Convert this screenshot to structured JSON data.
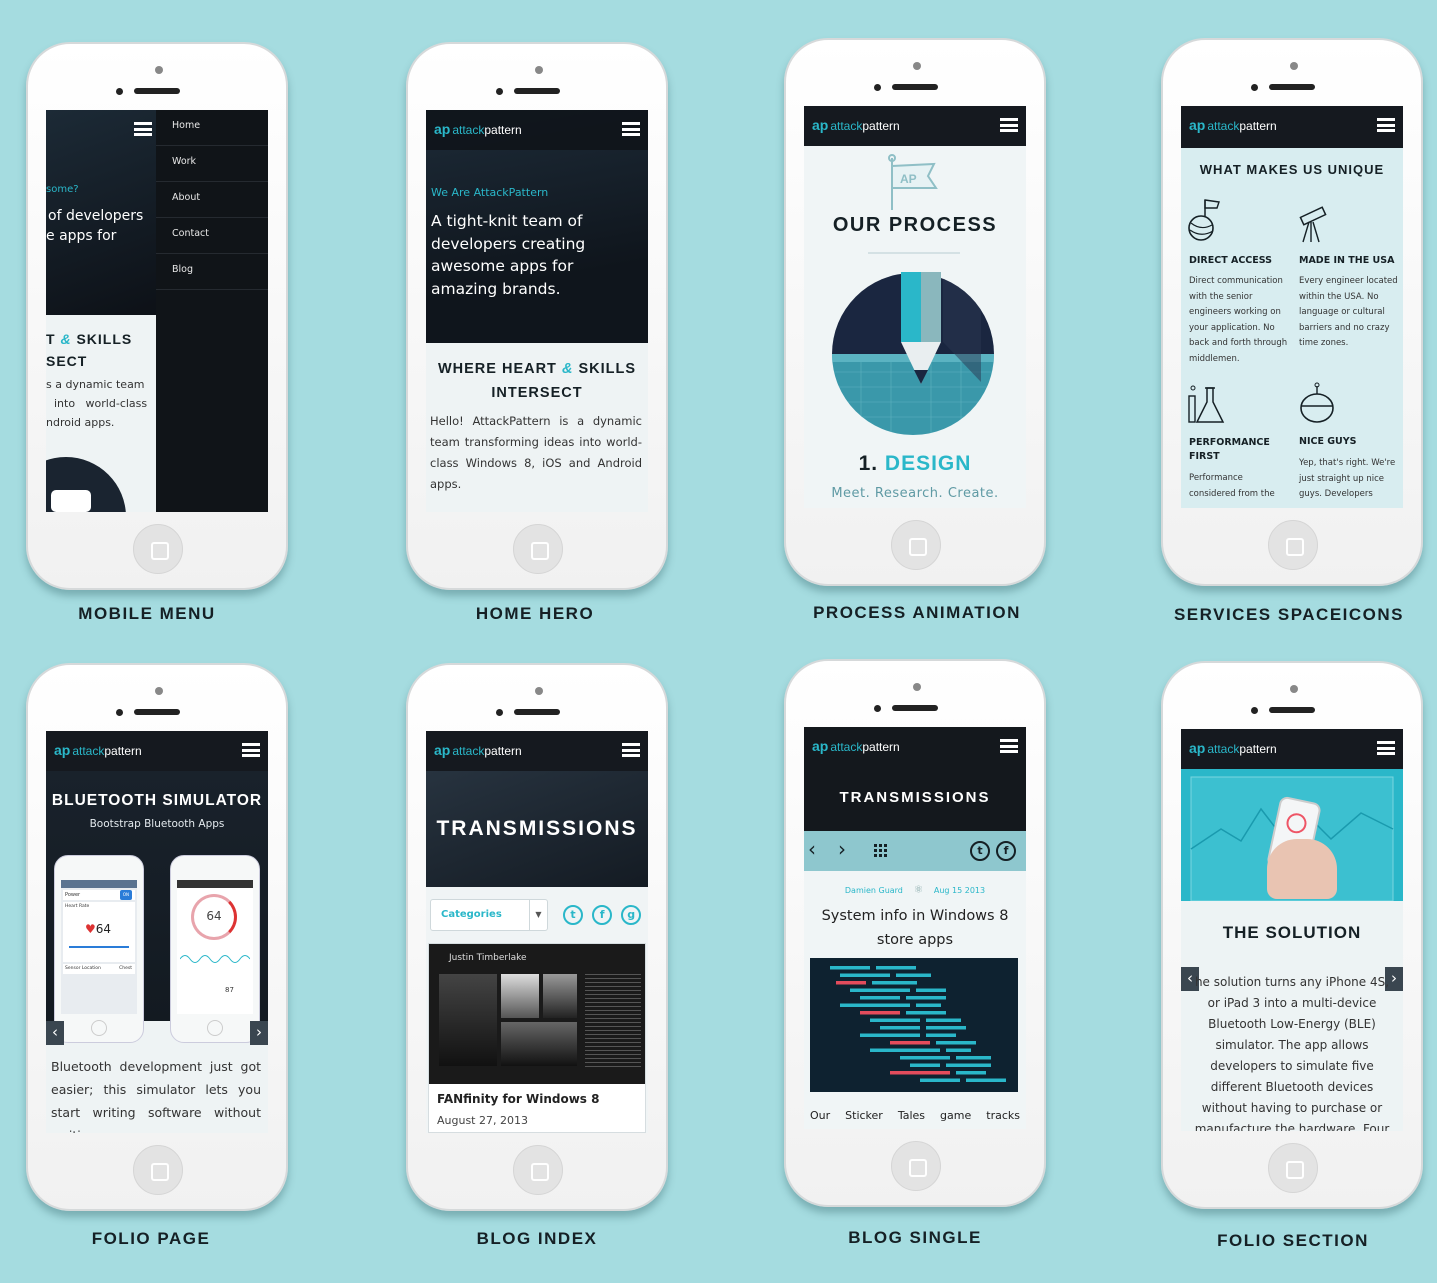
{
  "brand": {
    "ap": "ap",
    "name_light": "attack",
    "name_bold": "pattern"
  },
  "captions": [
    "MOBILE MENU",
    "HOME HERO",
    "PROCESS ANIMATION",
    "SERVICES SPACEICONS",
    "FOLIO PAGE",
    "BLOG INDEX",
    "BLOG SINGLE",
    "FOLIO SECTION"
  ],
  "mobile_menu": {
    "items": [
      "Home",
      "Work",
      "About",
      "Contact",
      "Blog"
    ],
    "bg_kicker": "some?",
    "bg_line1": "of developers",
    "bg_line2": "e apps for",
    "heading1_a": "T",
    "heading1_b": "SKILLS",
    "heading2": "SECT",
    "body1": "s a dynamic team",
    "body2": "into   world-class",
    "body3": "ndroid apps."
  },
  "home_hero": {
    "kicker": "We Are AttackPattern",
    "headline": "A tight-knit team of developers creating awesome apps for amazing brands.",
    "heading_a": "WHERE HEART",
    "heading_b": "SKILLS",
    "heading2": "INTERSECT",
    "body": "Hello! AttackPattern is a dynamic team transforming ideas into world-class Windows 8, iOS and Android apps."
  },
  "process": {
    "flag": "AP",
    "title": "OUR PROCESS",
    "step_number": "1.",
    "step_name": "DESIGN",
    "subtitle": "Meet. Research. Create."
  },
  "services": {
    "title": "WHAT MAKES US UNIQUE",
    "items": [
      {
        "title": "DIRECT ACCESS",
        "text": "Direct communication with the senior engineers working on your application. No back and forth through middlemen."
      },
      {
        "title": "MADE IN THE USA",
        "text": "Every engineer located within the USA. No language or cultural barriers and no crazy time zones."
      },
      {
        "title": "PERFORMANCE FIRST",
        "text": "Performance considered from the"
      },
      {
        "title": "NICE GUYS",
        "text": "Yep, that's right. We're just straight up nice guys. Developers"
      }
    ]
  },
  "folio": {
    "title": "BLUETOOTH SIMULATOR",
    "subtitle": "Bootstrap Bluetooth Apps",
    "body": "Bluetooth development just got easier; this simulator lets you start writing software without waiting",
    "phone_left": {
      "heart": "64",
      "power": "Power",
      "on": "ON",
      "heart_rate": "Heart Rate",
      "sensor": "Sensor Location",
      "chest": "Chest"
    },
    "phone_right": {
      "value": "64",
      "bottom": "87"
    }
  },
  "blog_index": {
    "title": "TRANSMISSIONS",
    "dropdown": "Categories",
    "social": [
      "t",
      "f",
      "g"
    ],
    "post_title": "FANfinity for Windows 8",
    "post_date": "August 27, 2013",
    "image_caption": "Justin Timberlake"
  },
  "blog_single": {
    "title": "TRANSMISSIONS",
    "author": "Damien Guard",
    "date": "Aug 15 2013",
    "post_title": "System info in Windows 8 store apps",
    "footer_words": [
      "Our",
      "Sticker",
      "Tales",
      "game",
      "tracks"
    ]
  },
  "folio_section": {
    "title": "THE SOLUTION",
    "body": "he solution turns any iPhone 4S, or iPad 3 into a multi-device Bluetooth Low-Energy (BLE) simulator. The app allows developers to simulate five different Bluetooth devices without having to purchase or manufacture the hardware. Four Bluetooth"
  }
}
